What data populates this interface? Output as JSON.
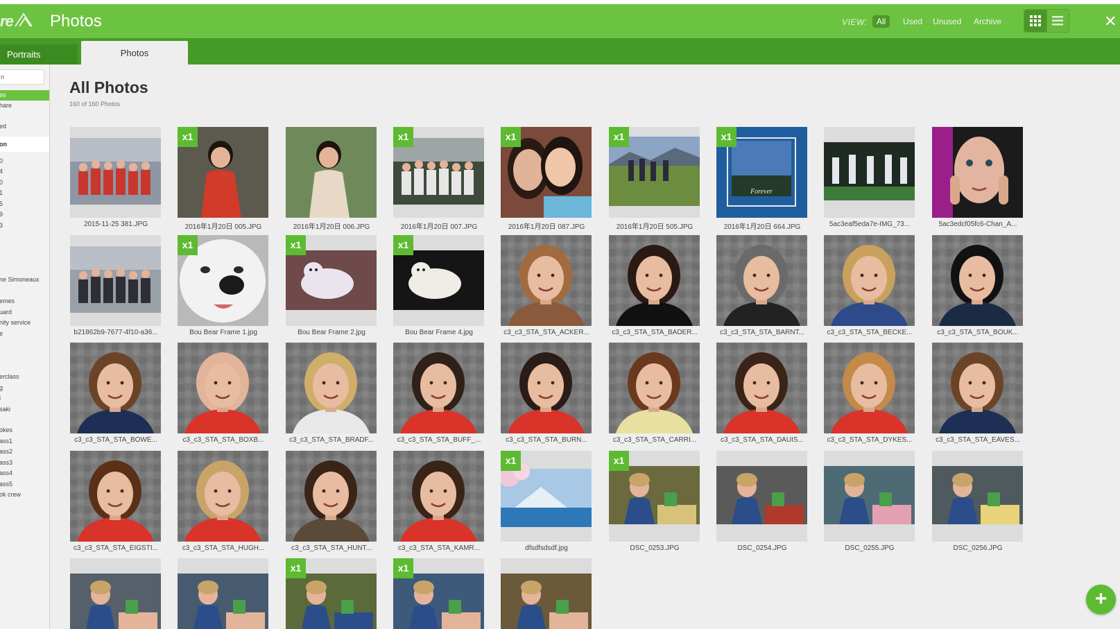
{
  "app": {
    "title": "Photos",
    "logo_text": "re",
    "view_label": "VIEW:",
    "view_options": [
      "All",
      "Used",
      "Unused",
      "Archive"
    ],
    "active_view": "All",
    "close_glyph": "✕"
  },
  "tabs": [
    {
      "label": "Portraits",
      "active": false
    },
    {
      "label": "Photos",
      "active": true
    }
  ],
  "sidebar": {
    "search_value": "n",
    "items": [
      {
        "label": "es",
        "style": "green"
      },
      {
        "label": "hare",
        "style": ""
      },
      {
        "label": "ed",
        "style": ""
      },
      {
        "label": "on",
        "style": "white"
      },
      {
        "label": "0",
        "style": ""
      },
      {
        "label": "4",
        "style": ""
      },
      {
        "label": "0",
        "style": ""
      },
      {
        "label": "1",
        "style": ""
      },
      {
        "label": "5",
        "style": ""
      },
      {
        "label": "9",
        "style": ""
      },
      {
        "label": "3",
        "style": ""
      },
      {
        "label": "ne Simoneaux",
        "style": ""
      },
      {
        "label": "emes",
        "style": ""
      },
      {
        "label": "uard",
        "style": ""
      },
      {
        "label": "nity service",
        "style": ""
      },
      {
        "label": "e",
        "style": ""
      },
      {
        "label": "erclass",
        "style": ""
      },
      {
        "label": "g",
        "style": ""
      },
      {
        "label": "l",
        "style": ""
      },
      {
        "label": "saki",
        "style": ""
      },
      {
        "label": "okes",
        "style": ""
      },
      {
        "label": "ass1",
        "style": ""
      },
      {
        "label": "ass2",
        "style": ""
      },
      {
        "label": "ass3",
        "style": ""
      },
      {
        "label": "ass4",
        "style": ""
      },
      {
        "label": "ass5",
        "style": ""
      },
      {
        "label": "ok crew",
        "style": ""
      }
    ]
  },
  "main": {
    "title": "All Photos",
    "subtitle": "160 of 160 Photos"
  },
  "photos": [
    {
      "name": "2015-11-25 381.JPG",
      "badge": "",
      "kind": "group",
      "bg": "#8f96a4",
      "fg": "#c8372d"
    },
    {
      "name": "2016年1月20日 005.JPG",
      "badge": "x1",
      "kind": "kid",
      "bg": "#5c5a4e",
      "fg": "#d23a2a"
    },
    {
      "name": "2016年1月20日 006.JPG",
      "badge": "",
      "kind": "kid",
      "bg": "#6f8a5a",
      "fg": "#e7d9c6"
    },
    {
      "name": "2016年1月20日 007.JPG",
      "badge": "x1",
      "kind": "group",
      "bg": "#3e4a3a",
      "fg": "#e6e6e6"
    },
    {
      "name": "2016年1月20日 087.JPG",
      "badge": "x1",
      "kind": "selfie",
      "bg": "#7b4a3a",
      "fg": "#e1b49a"
    },
    {
      "name": "2016年1月20日 505.JPG",
      "badge": "x1",
      "kind": "field",
      "bg": "#8da5c4",
      "fg": "#6c8d3f"
    },
    {
      "name": "2016年1月20日 664.JPG",
      "badge": "x1",
      "kind": "frame",
      "bg": "#1f5e9e",
      "fg": "#e9e9e9"
    },
    {
      "name": "5ac3eaf5eda7e-IMG_73...",
      "badge": "",
      "kind": "dance",
      "bg": "#1e2a22",
      "fg": "#e6e6ef"
    },
    {
      "name": "5ac3edcf05fc6-Chan_A...",
      "badge": "",
      "kind": "face",
      "bg": "#9b1f8a",
      "fg": "#e3b4a0"
    },
    {
      "name": "b21862b9-7677-4f10-a36...",
      "badge": "",
      "kind": "group",
      "bg": "#9aa0a8",
      "fg": "#2e2e36"
    },
    {
      "name": "Bou Bear Frame 1.jpg",
      "badge": "x1",
      "kind": "dog",
      "bg": "#b9b9b9",
      "fg": "#f2f2f2"
    },
    {
      "name": "Bou Bear Frame 2.jpg",
      "badge": "x1",
      "kind": "dog2",
      "bg": "#6e4a4a",
      "fg": "#e9e4ee"
    },
    {
      "name": "Bou Bear Frame 4.jpg",
      "badge": "x1",
      "kind": "dog2",
      "bg": "#151515",
      "fg": "#f0ede6"
    },
    {
      "name": "c3_c3_STA_STA_ACKER...",
      "badge": "",
      "kind": "portrait",
      "bg": "#7a7a7a",
      "fg": "#a36b3d",
      "shirt": "#8b5a3c"
    },
    {
      "name": "c3_c3_STA_STA_BADER...",
      "badge": "",
      "kind": "portrait",
      "bg": "#7a7a7a",
      "fg": "#2b1a14",
      "shirt": "#111111"
    },
    {
      "name": "c3_c3_STA_STA_BARNT...",
      "badge": "",
      "kind": "portrait",
      "bg": "#7a7a7a",
      "fg": "#6a6a6a",
      "shirt": "#222222"
    },
    {
      "name": "c3_c3_STA_STA_BECKE...",
      "badge": "",
      "kind": "portrait",
      "bg": "#7a7a7a",
      "fg": "#c9a15c",
      "shirt": "#2d4a8a"
    },
    {
      "name": "c3_c3_STA_STA_BOUK...",
      "badge": "",
      "kind": "portrait",
      "bg": "#7a7a7a",
      "fg": "#111111",
      "shirt": "#1c2b44"
    },
    {
      "name": "c3_c3_STA_STA_BOWE...",
      "badge": "",
      "kind": "portrait",
      "bg": "#7a7a7a",
      "fg": "#6b4428",
      "shirt": "#1d2f55"
    },
    {
      "name": "c3_c3_STA_STA_BOXB...",
      "badge": "",
      "kind": "portrait",
      "bg": "#7a7a7a",
      "fg": "#e2b49a",
      "shirt": "#d9332a"
    },
    {
      "name": "c3_c3_STA_STA_BRADF...",
      "badge": "",
      "kind": "portrait",
      "bg": "#7a7a7a",
      "fg": "#cfae6a",
      "shirt": "#e8e8e8"
    },
    {
      "name": "c3_c3_STA_STA_BUFF_...",
      "badge": "",
      "kind": "portrait",
      "bg": "#7a7a7a",
      "fg": "#2f211a",
      "shirt": "#d9332a"
    },
    {
      "name": "c3_c3_STA_STA_BURN...",
      "badge": "",
      "kind": "portrait",
      "bg": "#7a7a7a",
      "fg": "#2a1c16",
      "shirt": "#d9332a"
    },
    {
      "name": "c3_c3_STA_STA_CARRI...",
      "badge": "",
      "kind": "portrait",
      "bg": "#7a7a7a",
      "fg": "#6b3a1e",
      "shirt": "#e8e0a0"
    },
    {
      "name": "c3_c3_STA_STA_DAUIS...",
      "badge": "",
      "kind": "portrait",
      "bg": "#7a7a7a",
      "fg": "#3a2418",
      "shirt": "#d9332a"
    },
    {
      "name": "c3_c3_STA_STA_DYKES...",
      "badge": "",
      "kind": "portrait",
      "bg": "#7a7a7a",
      "fg": "#c48a4a",
      "shirt": "#d9332a"
    },
    {
      "name": "c3_c3_STA_STA_EAVES...",
      "badge": "",
      "kind": "portrait",
      "bg": "#7a7a7a",
      "fg": "#6b4428",
      "shirt": "#1d2f55"
    },
    {
      "name": "c3_c3_STA_STA_EIGSTI...",
      "badge": "",
      "kind": "portrait",
      "bg": "#7a7a7a",
      "fg": "#5b3018",
      "shirt": "#d9332a"
    },
    {
      "name": "c3_c3_STA_STA_HUGH...",
      "badge": "",
      "kind": "portrait",
      "bg": "#7a7a7a",
      "fg": "#c9a468",
      "shirt": "#d9332a"
    },
    {
      "name": "c3_c3_STA_STA_HUNT...",
      "badge": "",
      "kind": "portrait",
      "bg": "#7a7a7a",
      "fg": "#3a2418",
      "shirt": "#5a4a38"
    },
    {
      "name": "c3_c3_STA_STA_KAMR...",
      "badge": "",
      "kind": "portrait",
      "bg": "#7a7a7a",
      "fg": "#3a2418",
      "shirt": "#d9332a"
    },
    {
      "name": "dfsdfsdsdf.jpg",
      "badge": "x1",
      "kind": "mountain",
      "bg": "#a9c8e6",
      "fg": "#2e78b8"
    },
    {
      "name": "DSC_0253.JPG",
      "badge": "x1",
      "kind": "class",
      "bg": "#6a6a3e",
      "fg": "#d8c27a"
    },
    {
      "name": "DSC_0254.JPG",
      "badge": "",
      "kind": "class",
      "bg": "#5a5a5a",
      "fg": "#b0392e"
    },
    {
      "name": "DSC_0255.JPG",
      "badge": "",
      "kind": "class",
      "bg": "#4e6a74",
      "fg": "#e3a0b2"
    },
    {
      "name": "DSC_0256.JPG",
      "badge": "",
      "kind": "class",
      "bg": "#4e5a5e",
      "fg": "#e8d27a"
    },
    {
      "name": "",
      "badge": "",
      "kind": "class",
      "bg": "#56606a",
      "fg": "#e3b49a"
    },
    {
      "name": "",
      "badge": "",
      "kind": "class",
      "bg": "#485a70",
      "fg": "#e3b49a"
    },
    {
      "name": "",
      "badge": "x1",
      "kind": "class",
      "bg": "#5a6a3a",
      "fg": "#2b4d8a"
    },
    {
      "name": "",
      "badge": "x1",
      "kind": "class",
      "bg": "#3e5a7a",
      "fg": "#e3b49a"
    },
    {
      "name": "",
      "badge": "",
      "kind": "class",
      "bg": "#6a5a3a",
      "fg": "#e3b49a"
    }
  ],
  "fab": {
    "label": "+"
  }
}
